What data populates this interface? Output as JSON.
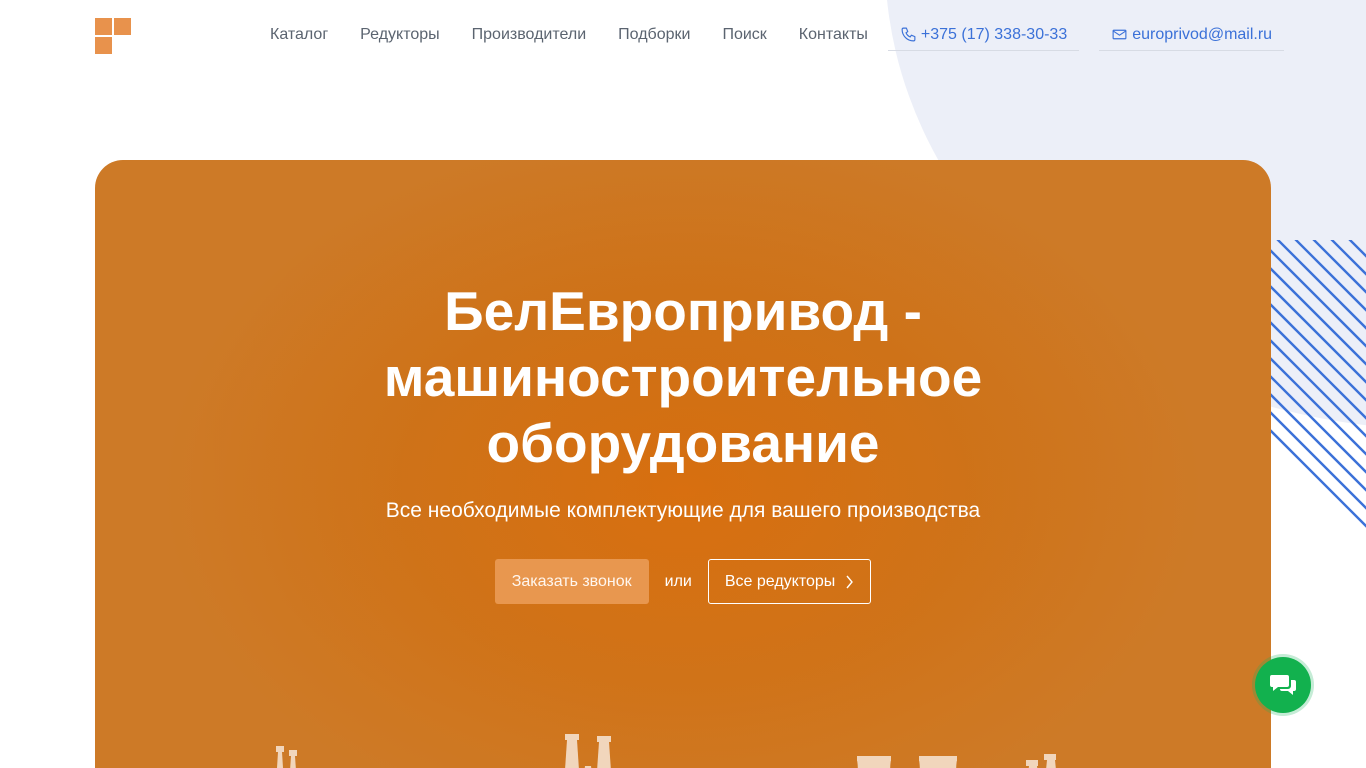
{
  "header": {
    "nav": [
      {
        "label": "Каталог"
      },
      {
        "label": "Редукторы"
      },
      {
        "label": "Производители"
      },
      {
        "label": "Подборки"
      },
      {
        "label": "Поиск"
      },
      {
        "label": "Контакты"
      }
    ],
    "phone": "+375 (17) 338-30-33",
    "email": "europrivod@mail.ru",
    "phone_icon": "phone-icon",
    "email_icon": "envelope-icon",
    "logo_icon": "logo-icon"
  },
  "hero": {
    "title_lines": [
      "БелЕвропривод -",
      "машиностроительное",
      "оборудование"
    ],
    "subtitle": "Все необходимые комплектующие для вашего производства",
    "call_button": "Заказать звонок",
    "or_text": "или",
    "all_button": "Все редукторы",
    "all_button_icon": "chevron-right-icon"
  },
  "chat": {
    "icon": "chat-bubbles-icon"
  },
  "colors": {
    "accent_orange": "#d97212",
    "logo_orange": "#e8924c",
    "link_blue": "#3b71d8",
    "nav_gray": "#5b6470",
    "stripe_blue": "#3b71d8",
    "chat_green": "#12b14e",
    "decor_bg": "#eceff8"
  }
}
